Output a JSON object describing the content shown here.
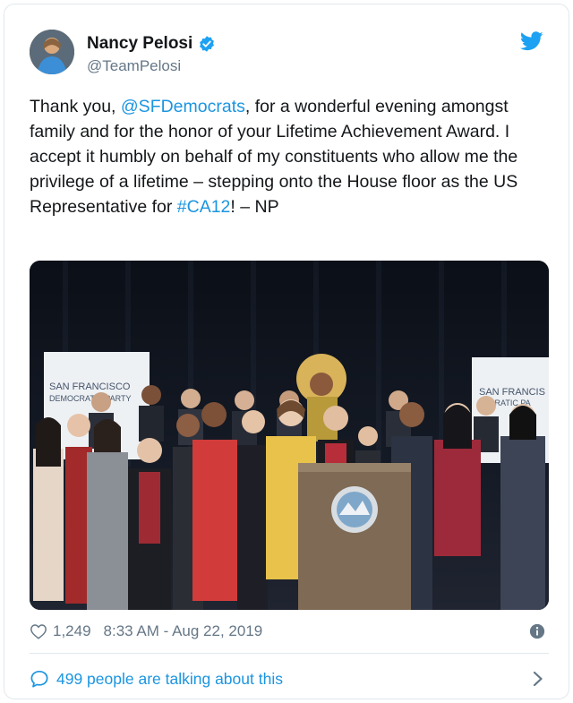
{
  "author": {
    "name": "Nancy Pelosi",
    "handle": "@TeamPelosi",
    "verified": true
  },
  "tweet": {
    "text_before": "Thank you, ",
    "mention": "@SFDemocrats",
    "text_middle": ", for a wonderful evening amongst family and for the honor of your Lifetime Achievement Award. I accept it humbly on behalf of my constituents who allow me the privilege of a lifetime – stepping onto the House floor as the US Representative for ",
    "hashtag": "#CA12",
    "text_after": "!  – NP"
  },
  "media": {
    "banner_left_line1": "SAN FRANCISCO",
    "banner_left_line2": "DEMOCRATIC PARTY",
    "banner_right_line1": "SAN FRANCIS",
    "banner_right_line2": "OCRATIC PA"
  },
  "footer": {
    "likes": "1,249",
    "timestamp": "8:33 AM - Aug 22, 2019"
  },
  "conversation": {
    "label": "499 people are talking about this"
  },
  "colors": {
    "link": "#1b95e0",
    "secondary_text": "#657786",
    "border": "#e1e8ed"
  }
}
